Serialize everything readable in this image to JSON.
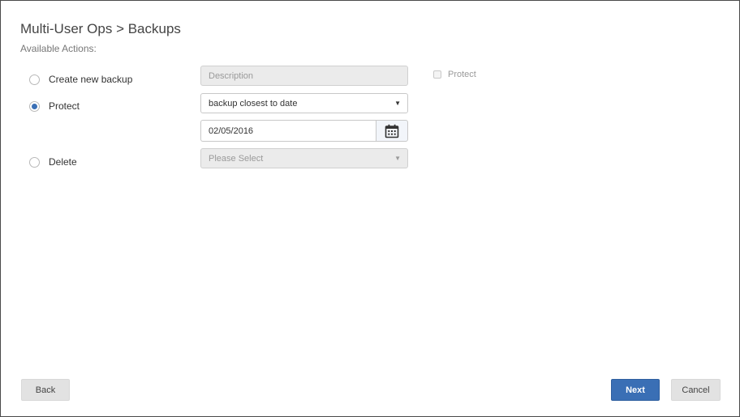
{
  "header": {
    "title": "Multi-User Ops > Backups",
    "subtitle": "Available Actions:"
  },
  "actions": [
    {
      "label": "Create new backup",
      "selected": false
    },
    {
      "label": "Protect",
      "selected": true
    },
    {
      "label": "Delete",
      "selected": false
    }
  ],
  "fields": {
    "description_placeholder": "Description",
    "protect_checkbox_label": "Protect",
    "protect_mode_value": "backup closest to date",
    "date_value": "02/05/2016",
    "delete_select_placeholder": "Please Select"
  },
  "icons": {
    "calendar": "calendar-icon",
    "dropdown": "chevron-down-icon"
  },
  "footer": {
    "back_label": "Back",
    "next_label": "Next",
    "cancel_label": "Cancel"
  },
  "colors": {
    "accent": "#3a6fb5",
    "disabled_bg": "#ebebeb"
  }
}
